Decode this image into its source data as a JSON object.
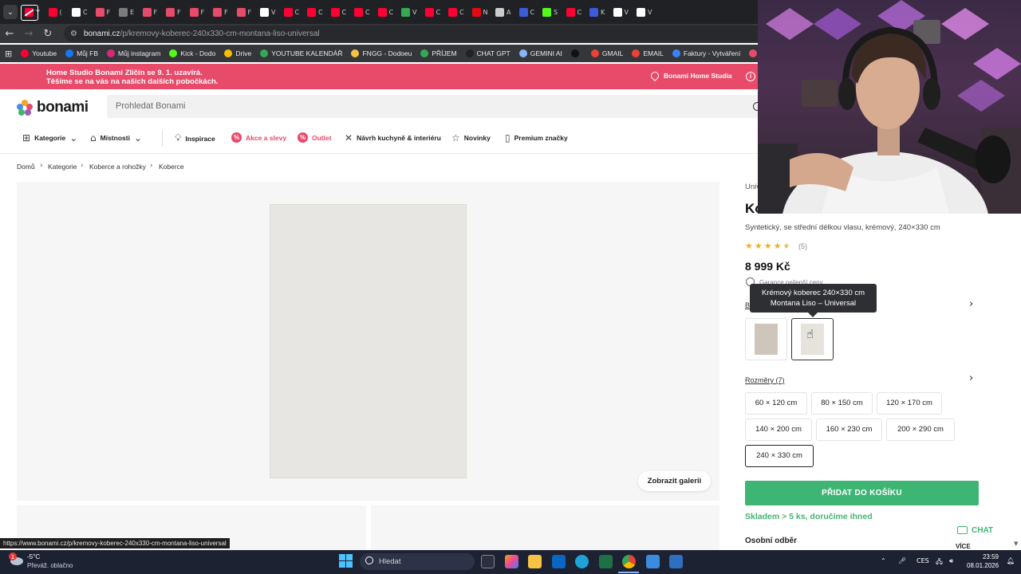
{
  "browser": {
    "tabs": [
      {
        "title": "Y",
        "color": "#ff0033"
      },
      {
        "title": "(",
        "color": "#ff0033"
      },
      {
        "title": "C",
        "color": "#ffffff"
      },
      {
        "title": "F",
        "color": "#e84a6a"
      },
      {
        "title": "E",
        "color": "#7c7c7c"
      },
      {
        "title": "F",
        "color": "#e84a6a"
      },
      {
        "title": "F",
        "color": "#e84a6a"
      },
      {
        "title": "F",
        "color": "#e84a6a"
      },
      {
        "title": "F",
        "color": "#e84a6a"
      },
      {
        "title": "F",
        "color": "#e84a6a"
      },
      {
        "title": "V",
        "color": "#ffffff"
      },
      {
        "title": "C",
        "color": "#ff0033"
      },
      {
        "title": "C",
        "color": "#ff0033"
      },
      {
        "title": "C",
        "color": "#ff0033"
      },
      {
        "title": "C",
        "color": "#ff0033"
      },
      {
        "title": "C",
        "color": "#ff0033"
      },
      {
        "title": "V",
        "color": "#34a853"
      },
      {
        "title": "C",
        "color": "#ff0033"
      },
      {
        "title": "C",
        "color": "#ff0033"
      },
      {
        "title": "N",
        "color": "#e50914"
      },
      {
        "title": "A",
        "color": "#cccccc"
      },
      {
        "title": "C",
        "color": "#3b5bdb"
      },
      {
        "title": "S",
        "color": "#53fc18"
      },
      {
        "title": "C",
        "color": "#ff0033"
      },
      {
        "title": "K",
        "color": "#3b5bdb"
      },
      {
        "title": "V",
        "color": "#ffffff"
      },
      {
        "title": "V",
        "color": "#ffffff"
      }
    ],
    "url_domain": "bonami.cz",
    "url_path": "/p/kremovy-koberec-240x330-cm-montana-liso-universal",
    "bookmarks": [
      {
        "label": "Youtube",
        "color": "#ff0033"
      },
      {
        "label": "Můj FB",
        "color": "#1877f2"
      },
      {
        "label": "Můj instagram",
        "color": "#d62976"
      },
      {
        "label": "Kick - Dodo",
        "color": "#53fc18"
      },
      {
        "label": "Drive",
        "color": "#fbbc04"
      },
      {
        "label": "YOUTUBE KALENDÁŘ",
        "color": "#34a853"
      },
      {
        "label": "FNGG - Dodoeu",
        "color": "#f5c242"
      },
      {
        "label": "PŘÍJEM",
        "color": "#34a853"
      },
      {
        "label": "CHAT GPT",
        "color": "#222222"
      },
      {
        "label": "GEMINI AI",
        "color": "#8ab4f8"
      },
      {
        "label": "",
        "color": "#111111"
      },
      {
        "label": "GMAIL",
        "color": "#ea4335"
      },
      {
        "label": "EMAIL",
        "color": "#ea4335"
      },
      {
        "label": "Faktury - Vytváření",
        "color": "#3b82f6"
      },
      {
        "label": "PNG to PDF",
        "color": "#e84a6a"
      }
    ],
    "status_url": "https://www.bonami.cz/p/kremovy-koberec-240x330-cm-montana-liso-universal"
  },
  "banner": {
    "line1": "Home Studio Bonami Zličín se 9. 1. uzavírá.",
    "line2": "Těšíme se na vás na našich dalších pobočkách.",
    "store_link": "Bonami Home Studia",
    "color": "#e84a6a"
  },
  "header": {
    "logo": "bonami",
    "search_placeholder": "Prohledat Bonami"
  },
  "nav": {
    "items": [
      {
        "label": "Kategorie"
      },
      {
        "label": "Místnosti"
      },
      {
        "label": "Inspirace"
      },
      {
        "label": "Akce a slevy"
      },
      {
        "label": "Outlet"
      },
      {
        "label": "Návrh kuchyně & interiéru"
      },
      {
        "label": "Novinky"
      },
      {
        "label": "Premium značky"
      }
    ]
  },
  "breadcrumb": [
    "Domů",
    "Kategorie",
    "Koberce a rohožky",
    "Koberce"
  ],
  "gallery": {
    "show_gallery": "Zobrazit galerii"
  },
  "product": {
    "brand": "Univ",
    "title": "Ko",
    "subtitle": "Syntetický, se střední délkou vlasu, krémový, 240×330 cm",
    "rating": 4.5,
    "review_count": "(5)",
    "price": "8 999 Kč",
    "guarantee": "Garance nejlepší ceny",
    "variants_label": "B",
    "tooltip_line1": "Krémový koberec 240×330 cm",
    "tooltip_line2": "Montana Liso – Universal",
    "sizes_label": "Rozměry (7)",
    "sizes": [
      {
        "label": "60 × 120 cm",
        "selected": false
      },
      {
        "label": "80 × 150 cm",
        "selected": false
      },
      {
        "label": "120 × 170 cm",
        "selected": false
      },
      {
        "label": "140 × 200 cm",
        "selected": false
      },
      {
        "label": "160 × 230 cm",
        "selected": false
      },
      {
        "label": "200 × 290 cm",
        "selected": false
      },
      {
        "label": "240 × 330 cm",
        "selected": true
      }
    ],
    "add_to_cart": "PŘIDAT DO KOŠÍKU",
    "stock": "Skladem > 5 ks, doručíme ihned",
    "pickup": "Osobní odběr",
    "accent": "#3fb574"
  },
  "chat": {
    "label": "CHAT",
    "more": "VÍCE"
  },
  "taskbar": {
    "temp": "-5°C",
    "condition": "Převáž. oblačno",
    "search_placeholder": "Hledat",
    "lang": "CES",
    "time": "23:59",
    "date": "08.01.2026"
  }
}
